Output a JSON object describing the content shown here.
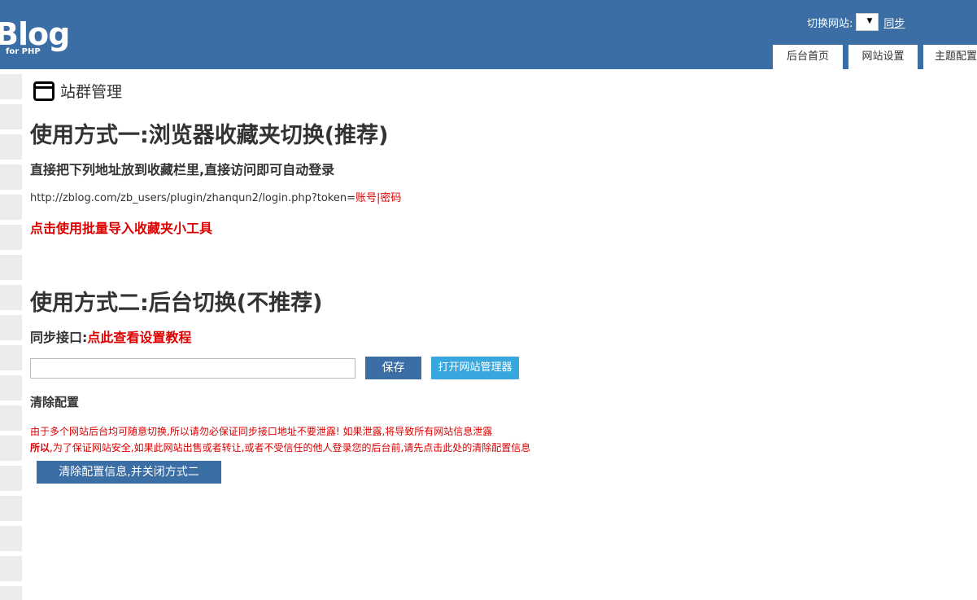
{
  "header": {
    "logo_text": "Blog",
    "logo_sub": "for PHP",
    "switch_label": "切换网站:",
    "select_arrow": "▼",
    "sync_link": "同步",
    "tabs": [
      {
        "label": "后台首页"
      },
      {
        "label": "网站设置"
      },
      {
        "label": "主题配置"
      }
    ]
  },
  "main": {
    "page_title": "站群管理",
    "method1": {
      "heading": "使用方式一:浏览器收藏夹切换(推荐)",
      "subheading": "直接把下列地址放到收藏栏里,直接访问即可自动登录",
      "url_prefix": "http://zblog.com/zb_users/plugin/zhanqun2/login.php?token=",
      "url_account": "账号",
      "url_sep": "|",
      "url_password": "密码",
      "tool_link": "点击使用批量导入收藏夹小工具"
    },
    "method2": {
      "heading": "使用方式二:后台切换(不推荐)",
      "sync_label": "同步接口:",
      "tutorial_link": "点此查看设置教程",
      "input_value": "",
      "save_label": "保存",
      "manager_label": "打开网站管理器",
      "clear_heading": "清除配置",
      "warning_line1": "由于多个网站后台均可随意切换,所以请勿必保证同步接口地址不要泄露! 如果泄露,将导致所有网站信息泄露",
      "warning_line2_bold": "所以",
      "warning_line2_rest": ",为了保证网站安全,如果此网站出售或者转让,或者不受信任的他人登录您的后台前,请先点击此处的清除配置信息",
      "clear_button": "清除配置信息,并关闭方式二"
    }
  },
  "colors": {
    "header_bg": "#3a6ea5",
    "accent_red": "#dd0000",
    "button_blue": "#3a6ea5",
    "button_light_blue": "#38a7dd"
  }
}
